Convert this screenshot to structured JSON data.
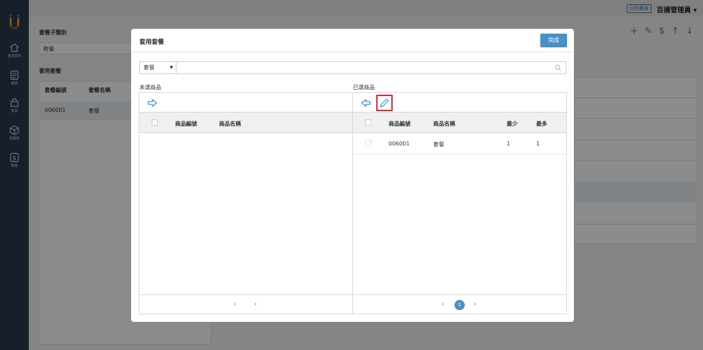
{
  "topbar": {
    "version_badge": "回到舊版",
    "user_name": "百揚管理員"
  },
  "sidebar": {
    "items": [
      {
        "label": "基本資料",
        "icon": "home-icon"
      },
      {
        "label": "報表",
        "icon": "report-icon"
      },
      {
        "label": "會員",
        "icon": "members-icon"
      },
      {
        "label": "進銷存",
        "icon": "box-icon"
      },
      {
        "label": "帳務",
        "icon": "dollar-icon"
      }
    ]
  },
  "background": {
    "subcategory_label": "套餐子類別",
    "subcategory_value": "附餐",
    "applied_label": "套用套餐",
    "columns": [
      "套餐編號",
      "套餐名稱"
    ],
    "rows": [
      {
        "code": "006001",
        "name": "套餐"
      }
    ]
  },
  "modal": {
    "title": "套用套餐",
    "done_label": "完成",
    "filter": {
      "selected": "套餐",
      "search_value": ""
    },
    "unselected": {
      "label": "未選商品",
      "columns": [
        "商品編號",
        "商品名稱"
      ],
      "rows": []
    },
    "selected": {
      "label": "已選商品",
      "columns": [
        "商品編號",
        "商品名稱",
        "最少",
        "最多"
      ],
      "rows": [
        {
          "code": "006001",
          "name": "套餐",
          "min": "1",
          "max": "1"
        }
      ],
      "current_page": "1"
    }
  },
  "colors": {
    "sidebar": "#2b3a4d",
    "accent": "#4a90c8",
    "highlight": "#e0262e"
  }
}
